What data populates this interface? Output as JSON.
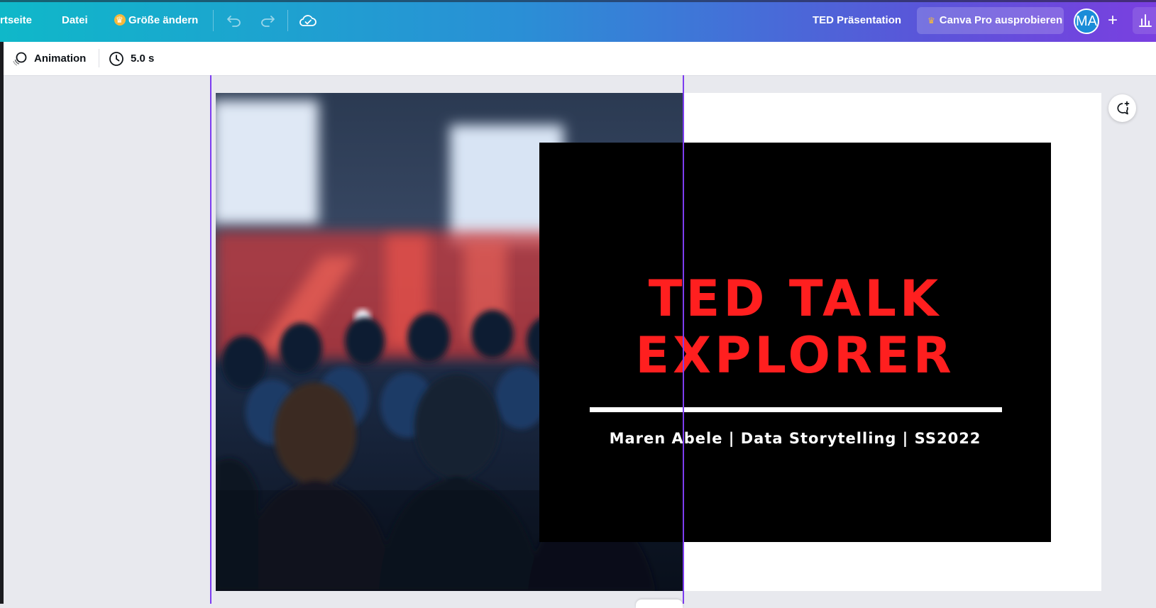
{
  "topbar": {
    "home_label": "rtseite",
    "file_label": "Datei",
    "resize_label": "Größe ändern",
    "doc_title": "TED Präsentation",
    "pro_label": "Canva Pro ausprobieren",
    "avatar_initials": "MA",
    "plus_label": "+",
    "gradient_start": "#0fb8c9",
    "gradient_end": "#7a3fe0"
  },
  "toolbar2": {
    "animation_label": "Animation",
    "duration_label": "5.0 s"
  },
  "slide": {
    "title": "TED TALK EXPLORER",
    "subtitle": "Maren Abele | Data Storytelling | SS2022",
    "title_color": "#ff1f1f",
    "box_color": "#000000"
  },
  "colors": {
    "guide": "#7d3df0",
    "canvas_bg": "#e8e9ee"
  }
}
